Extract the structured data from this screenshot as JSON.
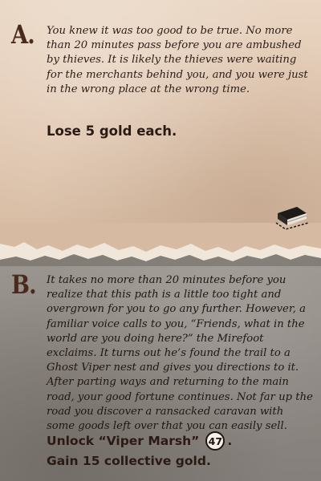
{
  "option_a": {
    "letter": "A.",
    "text": "You knew it was too good to be true. No more than 20 minutes pass before you are ambushed by thieves. It is likely the thieves were waiting for the merchants behind you, and you were just in the wrong place at the wrong time.",
    "result": "Lose 5 gold each.",
    "icon": "book-icon"
  },
  "option_b": {
    "letter": "B.",
    "text": "It takes no more than 20 minutes before you realize that this path is a little too tight and overgrown for you to go any further. However, a familiar voice calls to you, “Friends, what in the world are you doing here?” the Mirefoot exclaims. It turns out he’s found the trail to a Ghost Viper nest and gives you directions to it. After parting ways and returning to the main road, your good fortune continues. Not far up the road you discover a ransacked caravan with some goods left over that you can easily sell.",
    "unlock_label": "Unlock “Viper Marsh”",
    "unlock_number": "47",
    "unlock_suffix": ".",
    "gain": "Gain 15 collective gold."
  },
  "colors": {
    "parchment": "#e2c9b3",
    "stone": "#8d8782",
    "letter": "#4a2a1c",
    "text": "#2c1e17"
  }
}
